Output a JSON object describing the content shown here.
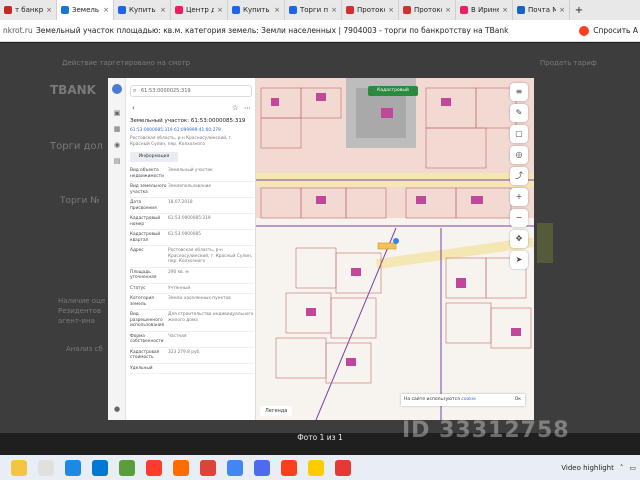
{
  "browser": {
    "tabs": [
      {
        "label": "т банкрот",
        "color": "#c62828"
      },
      {
        "label": "Земель",
        "color": "#1976d2",
        "active": true
      },
      {
        "label": "Купить Зе",
        "color": "#1e63e9"
      },
      {
        "label": "Центр ди",
        "color": "#e91e63"
      },
      {
        "label": "Купить Зе",
        "color": "#1e63e9"
      },
      {
        "label": "Торги по б",
        "color": "#1e63e9"
      },
      {
        "label": "Протокол",
        "color": "#d32f2f"
      },
      {
        "label": "Протокол",
        "color": "#d32f2f"
      },
      {
        "label": "В Ирине о",
        "color": "#e91e63"
      },
      {
        "label": "Почта Ма",
        "color": "#1565c0"
      }
    ],
    "host": "nkrot.ru",
    "page_title": "Земельный участок площадью: кв.м. категория земель: Земли населенных | 7904003 - торги по банкротству на TBank",
    "sign_label": "Спросить A"
  },
  "bg_texts": [
    "Действие таргетировано на смотр",
    "Продать тариф",
    "TBANK",
    "Торги дол",
    "Торги №",
    "Наличие оце",
    "Резидентов",
    "агент-ина",
    "Анализ сб"
  ],
  "panel": {
    "search_value": "61:53:0000025:319",
    "object_title": "Земельный участок: 61:53:0000085:319",
    "cad_line": "61:53:0000085:319   61:099999:41:00:279",
    "address_line": "Ростовская область, р-н Красносулинский, г. Красный Сулин, пер. Колхозного",
    "info_tab": "Информация",
    "rows": [
      {
        "k": "Вид объекта недвижимости",
        "v": "Земельный участок"
      },
      {
        "k": "Вид земельного участка",
        "v": "Землепользование"
      },
      {
        "k": "Дата присвоения",
        "v": "18.07.2018"
      },
      {
        "k": "Кадастровый номер",
        "v": "61:53:0000085:319"
      },
      {
        "k": "Кадастровый квартал",
        "v": "61:53:0000085"
      },
      {
        "k": "Адрес",
        "v": "Ростовская область, р-н Красносулинский, г. Красный Сулин, пер. Колхозного"
      },
      {
        "k": "Площадь уточненная",
        "v": "290 кв. м"
      },
      {
        "k": "Статус",
        "v": "Учтенный"
      },
      {
        "k": "Категория земель",
        "v": "Земли населенных пунктов"
      },
      {
        "k": "Вид разрешенного использования",
        "v": "Для строительства индивидуального жилого дома"
      },
      {
        "k": "Форма собственности",
        "v": "Частная"
      },
      {
        "k": "Кадастровая стоимость",
        "v": "323 279.8 руб."
      },
      {
        "k": "Удельный",
        "v": ""
      }
    ]
  },
  "map": {
    "green_chip": "Кадастровый",
    "legend": "Легенда",
    "banner_text": "На сайте используются",
    "banner_link": "cookie",
    "banner_ok": "Ок"
  },
  "watermark": "ID 33312758",
  "photo_counter": "Фото 1 из 1",
  "taskbar": {
    "apps": [
      "#f5c542",
      "#e0e0e0",
      "#1e88e5",
      "#0078d4",
      "#5a9e3b",
      "#ff3b30",
      "#ff6d00",
      "#db4437",
      "#4285f4",
      "#4f6bed",
      "#fc3f1d",
      "#ffcc00",
      "#e53935"
    ],
    "tray_text": "Video highlight"
  }
}
